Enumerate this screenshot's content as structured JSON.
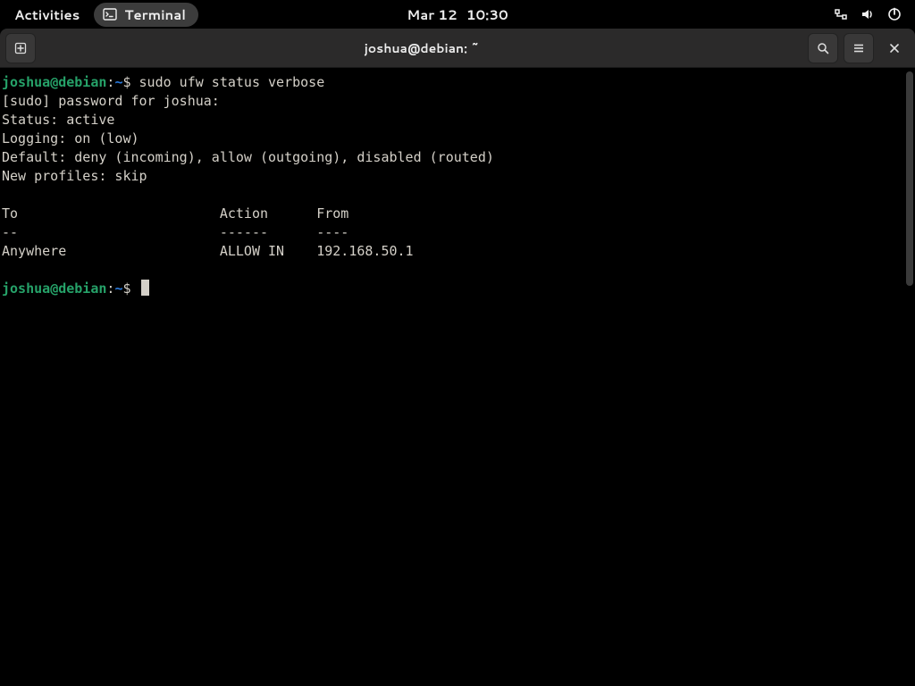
{
  "topbar": {
    "activities": "Activities",
    "app_label": "Terminal",
    "date": "Mar 12",
    "time": "10:30"
  },
  "window": {
    "title": "joshua@debian: ~"
  },
  "prompt": {
    "user": "joshua",
    "at": "@",
    "host": "debian",
    "colon": ":",
    "path": "~",
    "dollar": "$"
  },
  "terminal": {
    "command1": "sudo ufw status verbose",
    "lines": [
      "[sudo] password for joshua: ",
      "Status: active",
      "Logging: on (low)",
      "Default: deny (incoming), allow (outgoing), disabled (routed)",
      "New profiles: skip",
      "",
      "To                         Action      From",
      "--                         ------      ----",
      "Anywhere                   ALLOW IN    192.168.50.1              ",
      ""
    ]
  }
}
